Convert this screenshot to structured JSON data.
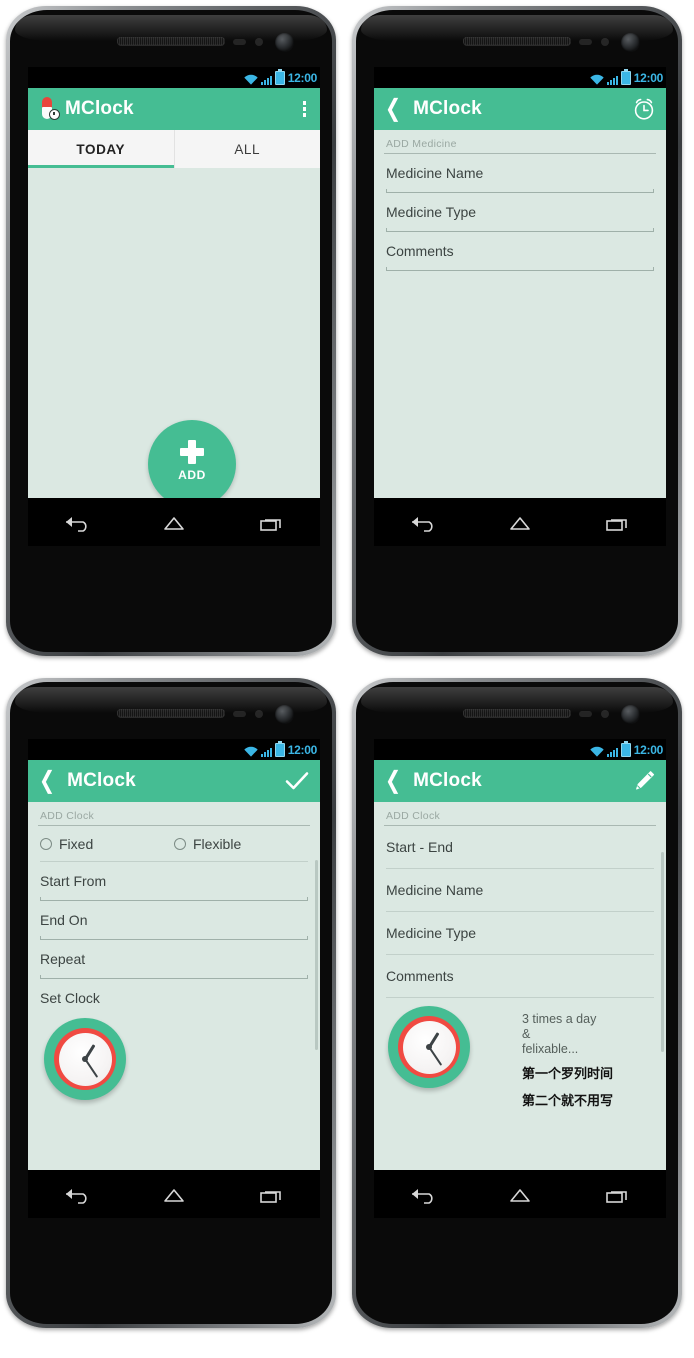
{
  "app": {
    "name": "MClock",
    "accent_color": "#45bd93",
    "screen_bg": "#dbe8e2",
    "tabbar_bg": "#f5f5f5",
    "clock_ring_color": "#f04a42",
    "status_text_color": "#3bb6e5"
  },
  "status_bar": {
    "time": "12:00",
    "icons": [
      "wifi-icon",
      "signal-icon",
      "battery-icon"
    ]
  },
  "nav_bar": {
    "buttons": [
      "back-button",
      "home-button",
      "recents-button"
    ]
  },
  "phones": [
    {
      "id": "phone-1",
      "screen_name": "today-list",
      "appbar": {
        "title": "MClock",
        "leading_icon": "app-logo-icon",
        "trailing_icon": "overflow-menu-icon"
      },
      "tabs": [
        {
          "label": "TODAY",
          "active": true
        },
        {
          "label": "ALL",
          "active": false
        }
      ],
      "fab": {
        "label": "ADD",
        "icon": "plus-icon"
      }
    },
    {
      "id": "phone-2",
      "screen_name": "add-medicine",
      "appbar": {
        "title": "MClock",
        "leading_icon": "back-chevron-icon",
        "trailing_icon": "alarm-clock-icon"
      },
      "section_title": "ADD Medicine",
      "fields": [
        {
          "label": "Medicine Name"
        },
        {
          "label": "Medicine Type"
        },
        {
          "label": "Comments"
        }
      ]
    },
    {
      "id": "phone-3",
      "screen_name": "add-clock-edit",
      "appbar": {
        "title": "MClock",
        "leading_icon": "back-chevron-icon",
        "trailing_icon": "checkmark-icon"
      },
      "section_title": "ADD Clock",
      "radios": [
        {
          "label": "Fixed",
          "selected": false
        },
        {
          "label": "Flexible",
          "selected": false
        }
      ],
      "fields": [
        {
          "label": "Start From"
        },
        {
          "label": "End On"
        },
        {
          "label": "Repeat"
        }
      ],
      "set_clock_label": "Set Clock",
      "clock_widget": "clock-widget"
    },
    {
      "id": "phone-4",
      "screen_name": "add-clock-view",
      "appbar": {
        "title": "MClock",
        "leading_icon": "back-chevron-icon",
        "trailing_icon": "pencil-edit-icon"
      },
      "section_title": "ADD Clock",
      "rows": [
        {
          "label": "Start - End"
        },
        {
          "label": "Medicine Name"
        },
        {
          "label": "Medicine Type"
        },
        {
          "label": "Comments"
        }
      ],
      "annotation": {
        "line1": "3 times a day",
        "line2": "&",
        "line3": "felixable...",
        "note1": "第一个罗列时间",
        "note2": "第二个就不用写"
      },
      "clock_widget": "clock-widget"
    }
  ]
}
